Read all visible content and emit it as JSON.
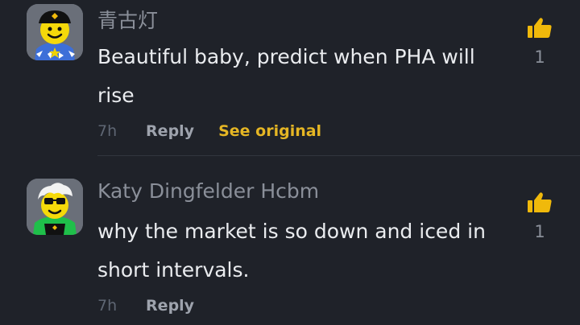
{
  "comments": [
    {
      "username": "青古灯",
      "text": "Beautiful baby, predict when PHA will rise",
      "likes": "1",
      "time": "7h",
      "reply_label": "Reply",
      "see_original_label": "See original"
    },
    {
      "username": "Katy Dingfelder Hcbm",
      "text": "why the market is so down and iced in short intervals.",
      "likes": "1",
      "time": "7h",
      "reply_label": "Reply"
    }
  ],
  "colors": {
    "background": "#1f2229",
    "accent": "#e5b624",
    "like_icon": "#f0b90b",
    "text_primary": "#eaecef",
    "text_secondary": "#8a8f99"
  },
  "icons": {
    "like": "thumbs-up-icon"
  }
}
